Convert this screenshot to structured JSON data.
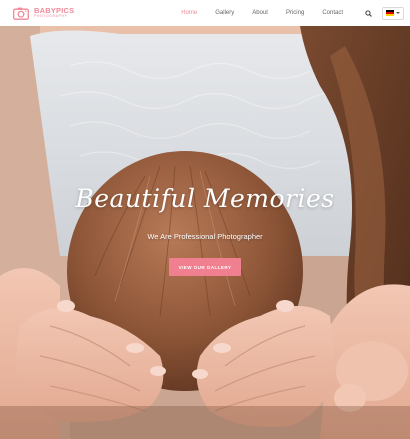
{
  "brand": {
    "name": "BABYPICS",
    "tagline": "PHOTOGRAPHY",
    "accent_color": "#f08a98",
    "icon": "camera-icon"
  },
  "nav": {
    "items": [
      {
        "label": "Home",
        "active": true
      },
      {
        "label": "Gallery",
        "active": false
      },
      {
        "label": "About",
        "active": false
      },
      {
        "label": "Pricing",
        "active": false
      },
      {
        "label": "Contact",
        "active": false
      }
    ],
    "search_icon": "search-icon",
    "language_icon": "german-flag-icon"
  },
  "hero": {
    "title": "Beautiful Memories",
    "subtitle": "We Are Professional Photographer",
    "button_label": "VIEW OUR GALLERY",
    "button_color": "#f07f8f"
  }
}
